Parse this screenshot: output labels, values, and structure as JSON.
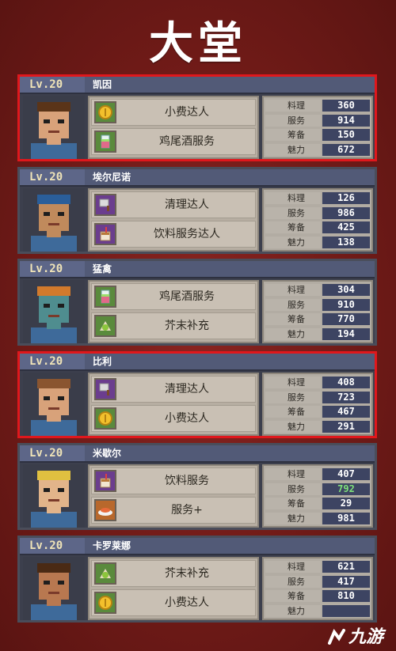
{
  "screen": {
    "title": "大堂"
  },
  "characters": [
    {
      "level": "Lv.20",
      "name": "凯因",
      "selected": true,
      "portrait": "bearded-man-glasses",
      "skin": "#d8a27a",
      "hair": "#5a3418",
      "skills": [
        {
          "label": "小费达人",
          "icon": "coin-icon"
        },
        {
          "label": "鸡尾酒服务",
          "icon": "cocktail-icon"
        }
      ],
      "stats": [
        {
          "label": "料理",
          "value": "360"
        },
        {
          "label": "服务",
          "value": "914"
        },
        {
          "label": "筹备",
          "value": "150"
        },
        {
          "label": "魅力",
          "value": "672"
        }
      ]
    },
    {
      "level": "Lv.20",
      "name": "埃尔尼诺",
      "selected": false,
      "portrait": "luchador-mask",
      "skin": "#c08a5c",
      "hair": "#2a5e9a",
      "skills": [
        {
          "label": "清理达人",
          "icon": "cleaver-icon"
        },
        {
          "label": "饮料服务达人",
          "icon": "drink-icon"
        }
      ],
      "stats": [
        {
          "label": "料理",
          "value": "126"
        },
        {
          "label": "服务",
          "value": "986"
        },
        {
          "label": "筹备",
          "value": "425"
        },
        {
          "label": "魅力",
          "value": "138"
        }
      ]
    },
    {
      "level": "Lv.20",
      "name": "猛禽",
      "selected": false,
      "portrait": "raptor-head",
      "skin": "#4f8d8f",
      "hair": "#d27a2c",
      "skills": [
        {
          "label": "鸡尾酒服务",
          "icon": "cocktail-icon"
        },
        {
          "label": "芥末补充",
          "icon": "wasabi-icon"
        }
      ],
      "stats": [
        {
          "label": "料理",
          "value": "304"
        },
        {
          "label": "服务",
          "value": "910"
        },
        {
          "label": "筹备",
          "value": "770"
        },
        {
          "label": "魅力",
          "value": "194"
        }
      ]
    },
    {
      "level": "Lv.20",
      "name": "比利",
      "selected": true,
      "portrait": "cyborg-man",
      "skin": "#d8a27a",
      "hair": "#8a5530",
      "skills": [
        {
          "label": "清理达人",
          "icon": "cleaver-icon"
        },
        {
          "label": "小费达人",
          "icon": "coin-icon"
        }
      ],
      "stats": [
        {
          "label": "料理",
          "value": "408"
        },
        {
          "label": "服务",
          "value": "723"
        },
        {
          "label": "筹备",
          "value": "467"
        },
        {
          "label": "魅力",
          "value": "291"
        }
      ]
    },
    {
      "level": "Lv.20",
      "name": "米歇尔",
      "selected": false,
      "portrait": "blond-headband-man",
      "skin": "#e2b48a",
      "hair": "#e0c040",
      "skills": [
        {
          "label": "饮料服务",
          "icon": "drink-icon"
        },
        {
          "label": "服务+",
          "icon": "dish-icon"
        }
      ],
      "stats": [
        {
          "label": "料理",
          "value": "407"
        },
        {
          "label": "服务",
          "value": "792",
          "highlight": true
        },
        {
          "label": "筹备",
          "value": "29"
        },
        {
          "label": "魅力",
          "value": "981"
        }
      ]
    },
    {
      "level": "Lv.20",
      "name": "卡罗莱娜",
      "selected": false,
      "portrait": "curly-hair-woman",
      "skin": "#b87850",
      "hair": "#4a2a14",
      "skills": [
        {
          "label": "芥末补充",
          "icon": "wasabi-icon"
        },
        {
          "label": "小费达人",
          "icon": "coin-icon"
        }
      ],
      "stats": [
        {
          "label": "料理",
          "value": "621"
        },
        {
          "label": "服务",
          "value": "417"
        },
        {
          "label": "筹备",
          "value": "810"
        },
        {
          "label": "魅力",
          "value": ""
        }
      ]
    }
  ],
  "watermark": {
    "text": "九游",
    "logo": "jiuyou-logo"
  }
}
